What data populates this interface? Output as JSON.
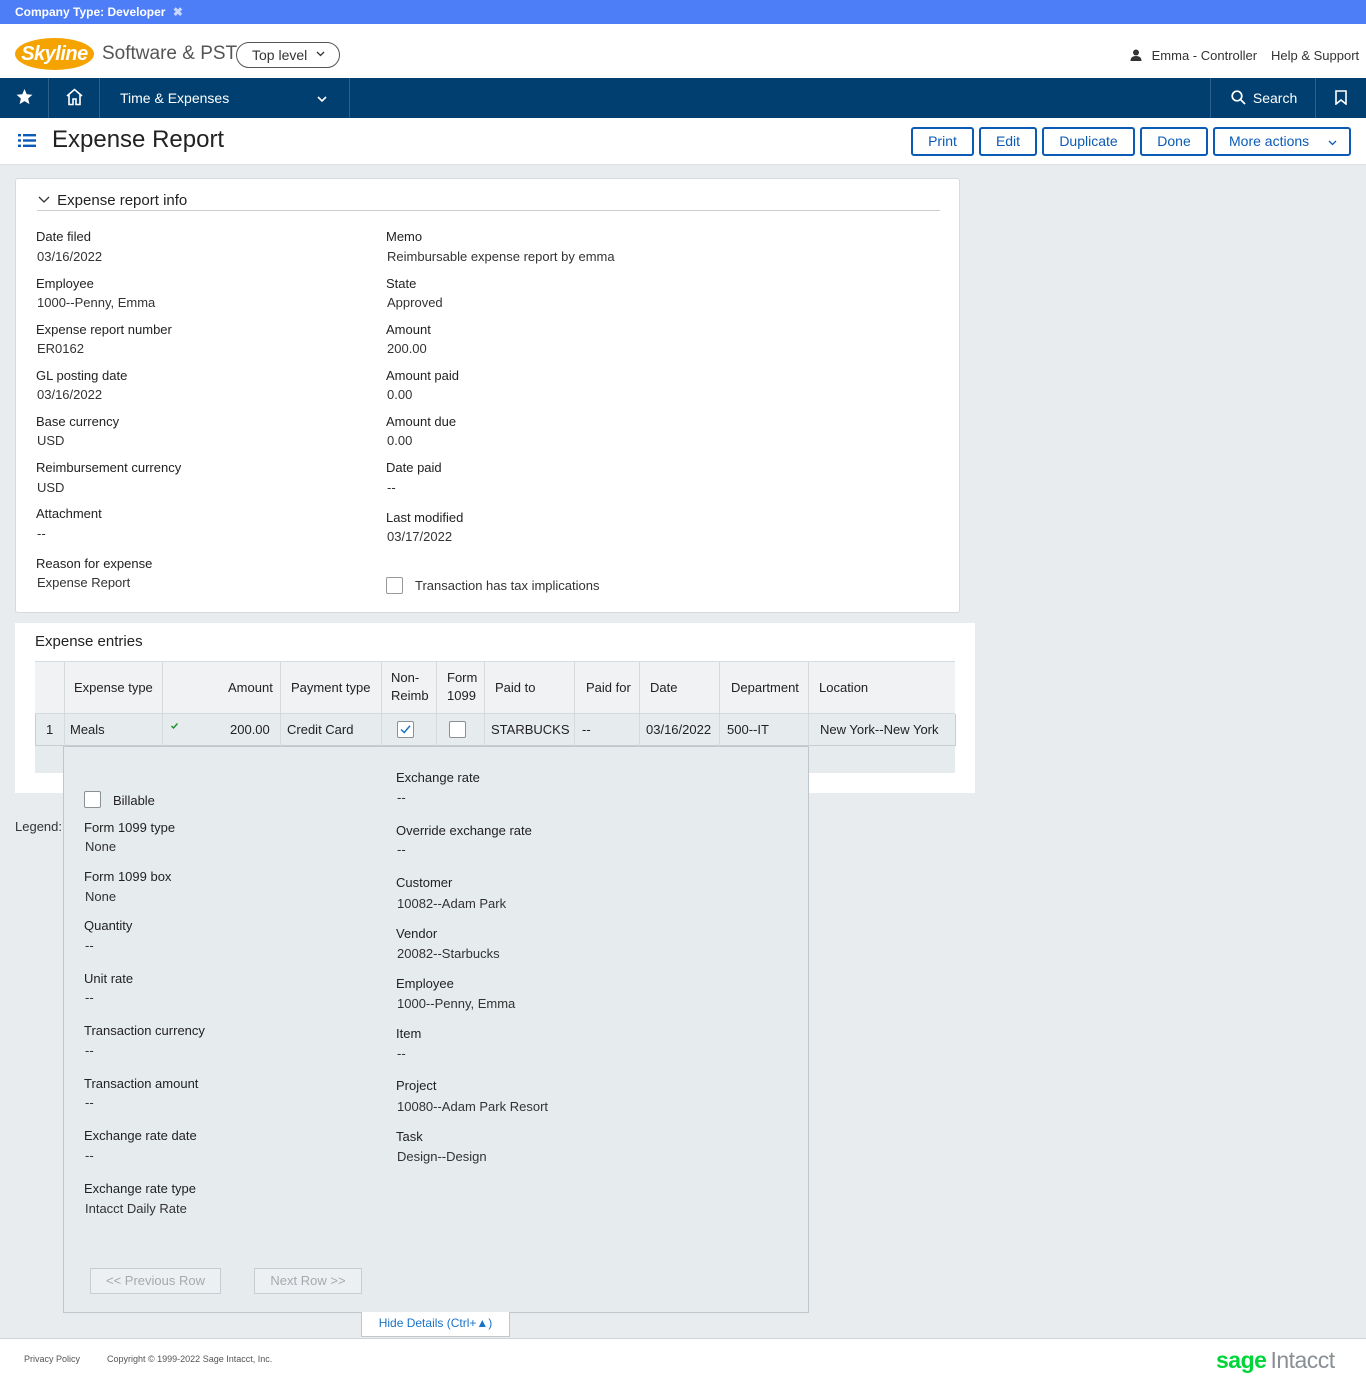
{
  "banner": {
    "label": "Company Type: Developer",
    "close": "✖"
  },
  "header": {
    "logo": "Skyline",
    "company": "Software & PST",
    "level": "Top level",
    "user": "Emma - Controller",
    "help": "Help & Support"
  },
  "nav": {
    "module": "Time & Expenses",
    "search": "Search"
  },
  "page": {
    "title": "Expense Report",
    "buttons": {
      "print": "Print",
      "edit": "Edit",
      "duplicate": "Duplicate",
      "done": "Done",
      "more": "More actions"
    }
  },
  "info": {
    "section_title": "Expense report info",
    "left": [
      {
        "label": "Date filed",
        "value": "03/16/2022"
      },
      {
        "label": "Employee",
        "value": "1000--Penny, Emma"
      },
      {
        "label": "Expense report number",
        "value": "ER0162"
      },
      {
        "label": "GL posting date",
        "value": "03/16/2022"
      },
      {
        "label": "Base currency",
        "value": "USD"
      },
      {
        "label": "Reimbursement currency",
        "value": "USD"
      },
      {
        "label": "Attachment",
        "value": "--"
      },
      {
        "label": "Reason for expense",
        "value": "Expense Report"
      }
    ],
    "right": [
      {
        "label": "Memo",
        "value": "Reimbursable expense report by emma"
      },
      {
        "label": "State",
        "value": "Approved"
      },
      {
        "label": "Amount",
        "value": "200.00"
      },
      {
        "label": "Amount paid",
        "value": "0.00"
      },
      {
        "label": "Amount due",
        "value": "0.00"
      },
      {
        "label": "Date paid",
        "value": "--"
      },
      {
        "label": "Last modified",
        "value": "03/17/2022"
      }
    ],
    "tax_checkbox": "Transaction has tax implications"
  },
  "entries": {
    "title": "Expense entries",
    "headers": {
      "expense_type": "Expense type",
      "amount": "Amount",
      "payment_type": "Payment type",
      "nonreimb_1": "Non-",
      "nonreimb_2": "Reimb",
      "form1099_1": "Form",
      "form1099_2": "1099",
      "paid_to": "Paid to",
      "paid_for": "Paid for",
      "date": "Date",
      "department": "Department",
      "location": "Location"
    },
    "row": {
      "num": "1",
      "expense_type": "Meals",
      "amount": "200.00",
      "payment_type": "Credit Card",
      "nonreimb": true,
      "form1099": false,
      "paid_to": "STARBUCKS",
      "paid_for": "--",
      "date": "03/16/2022",
      "department": "500--IT",
      "location": "New York--New York"
    }
  },
  "legend": "Legend:",
  "details": {
    "billable": "Billable",
    "left": [
      {
        "label": "Form 1099 type",
        "value": "None"
      },
      {
        "label": "Form 1099 box",
        "value": "None"
      },
      {
        "label": "Quantity",
        "value": "--"
      },
      {
        "label": "Unit rate",
        "value": "--"
      },
      {
        "label": "Transaction currency",
        "value": "--"
      },
      {
        "label": "Transaction amount",
        "value": "--"
      },
      {
        "label": "Exchange rate date",
        "value": "--"
      },
      {
        "label": "Exchange rate type",
        "value": "Intacct Daily Rate"
      }
    ],
    "right": [
      {
        "label": "Exchange rate",
        "value": "--"
      },
      {
        "label": "Override exchange rate",
        "value": "--"
      },
      {
        "label": "Customer",
        "value": "10082--Adam Park"
      },
      {
        "label": "Vendor",
        "value": "20082--Starbucks"
      },
      {
        "label": "Employee",
        "value": "1000--Penny, Emma"
      },
      {
        "label": "Item",
        "value": "--"
      },
      {
        "label": "Project",
        "value": "10080--Adam Park Resort"
      },
      {
        "label": "Task",
        "value": "Design--Design"
      }
    ],
    "prev": "<< Previous Row",
    "next": "Next Row >>",
    "hide": "Hide Details (Ctrl+▲)"
  },
  "footer": {
    "privacy": "Privacy Policy",
    "copyright": "Copyright © 1999-2022 Sage Intacct, Inc.",
    "brand_sage": "sage",
    "brand_intacct": "Intacct"
  },
  "colors": {
    "nav": "#003f6f",
    "banner": "#4d7ef7",
    "link": "#1a73c8",
    "sage_green": "#00d639"
  }
}
